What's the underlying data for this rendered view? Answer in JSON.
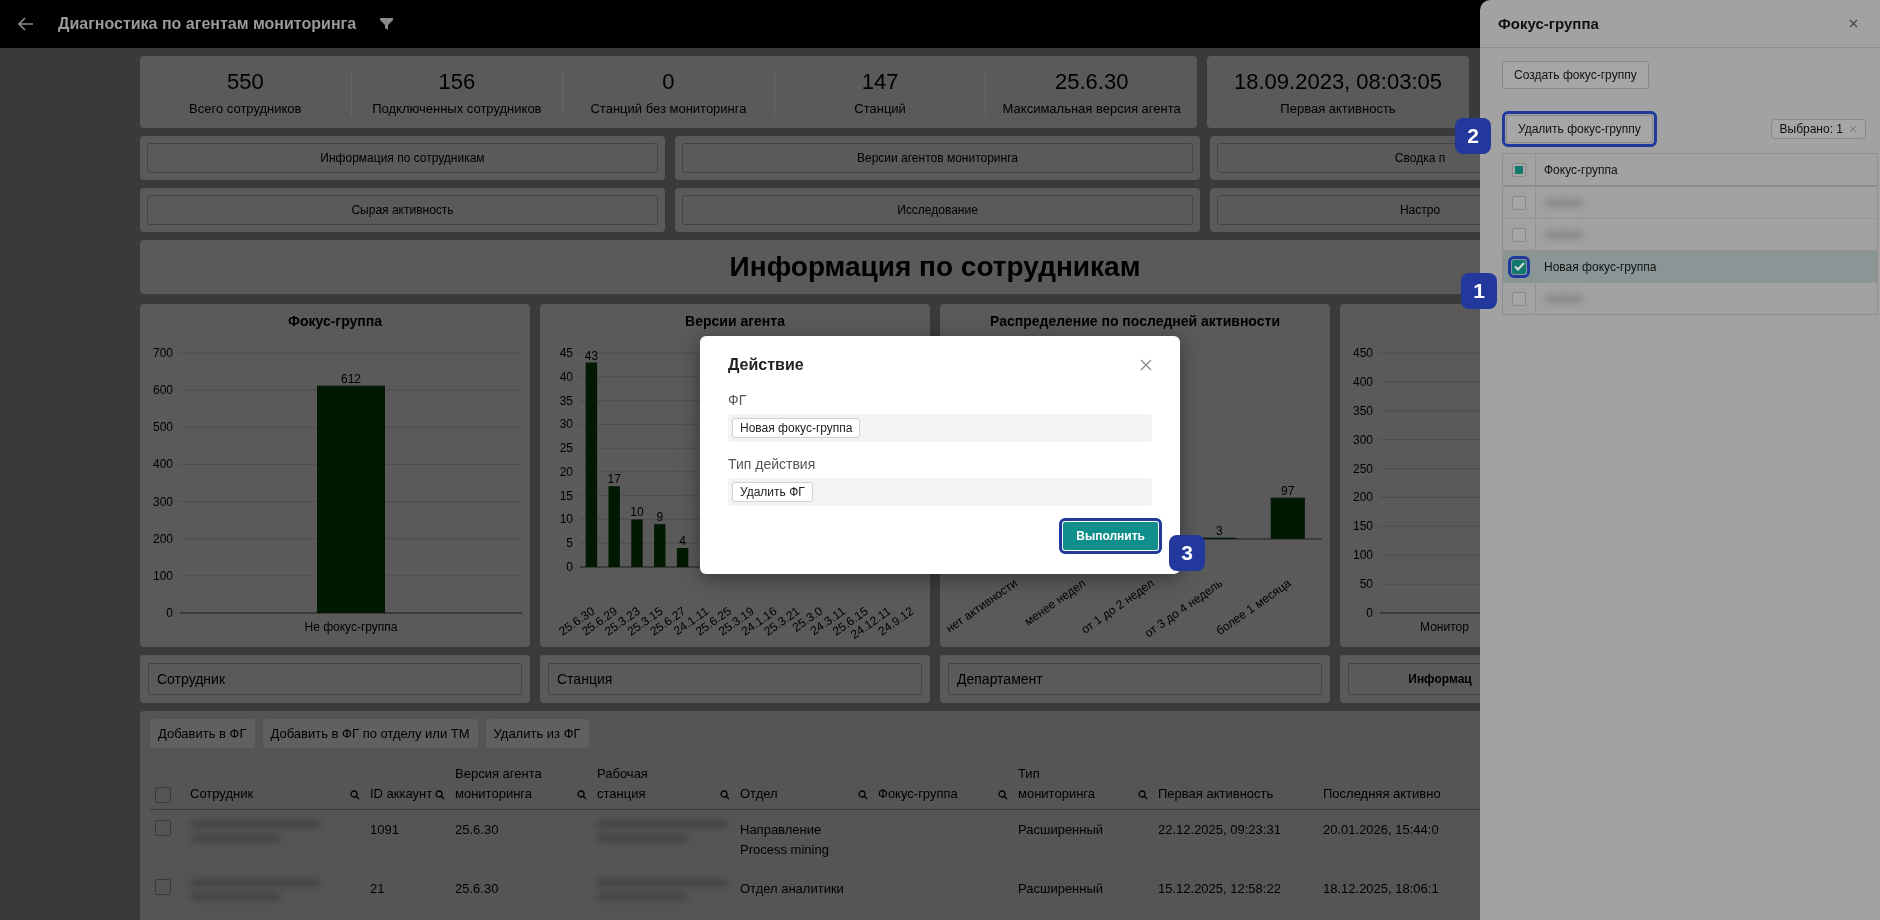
{
  "header": {
    "title": "Диагностика по агентам мониторинга"
  },
  "stats": [
    {
      "value": "550",
      "label": "Всего сотрудников"
    },
    {
      "value": "156",
      "label": "Подключенных сотрудников"
    },
    {
      "value": "0",
      "label": "Станций без мониторинга"
    },
    {
      "value": "147",
      "label": "Станций"
    },
    {
      "value": "25.6.30",
      "label": "Максимальная версия агента"
    }
  ],
  "first_activity": {
    "value": "18.09.2023, 08:03:05",
    "label": "Первая активность"
  },
  "nav_rows": [
    {
      "buttons": [
        "Информация по сотрудникам",
        "Версии агентов мониторинга",
        "Сводка п"
      ]
    },
    {
      "buttons": [
        "Сырая активность",
        "Исследование",
        "Настро"
      ]
    }
  ],
  "section_title": "Информация по сотрудникам",
  "charts": [
    {
      "title": "Фокус-группа",
      "chart_data": {
        "type": "bar",
        "categories": [
          "Не фокус-группа"
        ],
        "values": [
          612
        ],
        "ylim": [
          0,
          700
        ],
        "yticks": [
          0,
          100,
          200,
          300,
          400,
          500,
          600,
          700
        ],
        "grid": true,
        "value_labels": [
          "612"
        ]
      }
    },
    {
      "title": "Версии агента",
      "chart_data": {
        "type": "bar",
        "categories": [
          "25.6.30",
          "25.6.29",
          "25.3.23",
          "25.3.15",
          "25.6.27",
          "24.1.11",
          "25.6.25",
          "25.3.19",
          "24.1.16",
          "25.3.21",
          "25.3.0",
          "24.3.11",
          "25.6.15",
          "24.12.11",
          "24.9.12"
        ],
        "values": [
          43,
          17,
          10,
          9,
          4,
          null,
          null,
          null,
          null,
          null,
          null,
          null,
          null,
          null,
          null
        ],
        "ylim": [
          0,
          45
        ],
        "yticks": [
          0,
          5,
          10,
          15,
          20,
          25,
          30,
          35,
          40,
          45
        ],
        "grid": true,
        "value_labels": [
          "43",
          "17",
          "10",
          "9",
          "4",
          null,
          null,
          null,
          null,
          null,
          null,
          null,
          null,
          null,
          null
        ]
      }
    },
    {
      "title": "Распределение по последней активности",
      "chart_data": {
        "type": "bar",
        "categories": [
          "нет активности",
          "менее недел",
          "от 1 до 2 недел",
          "от 3 до 4 недель",
          "более 1 месяца"
        ],
        "values": [
          null,
          null,
          null,
          3,
          97
        ],
        "value_labels": [
          null,
          null,
          null,
          "3",
          "97"
        ]
      }
    },
    {
      "chart_data": {
        "type": "bar",
        "categories": [
          "Монитор"
        ],
        "values": [
          null
        ],
        "ylim": [
          0,
          450
        ],
        "yticks": [
          0,
          50,
          100,
          150,
          200,
          250,
          300,
          350,
          400,
          450
        ],
        "grid": true
      }
    }
  ],
  "filters": [
    {
      "placeholder": "Сотрудник"
    },
    {
      "placeholder": "Станция"
    },
    {
      "placeholder": "Департамент"
    }
  ],
  "filter_button": "Информац",
  "table": {
    "actions": [
      "Добавить в ФГ",
      "Добавить в ФГ по отделу или ТМ",
      "Удалить из ФГ"
    ],
    "all_checked": false,
    "columns": [
      {
        "label": "Сотрудник",
        "searchable": true
      },
      {
        "label": "ID аккаунт",
        "searchable": true
      },
      {
        "label": "Версия агента мониторинга",
        "searchable": true
      },
      {
        "label": "Рабочая станция",
        "searchable": true
      },
      {
        "label": "Отдел",
        "searchable": true
      },
      {
        "label": "Фокус-группа",
        "searchable": true
      },
      {
        "label": "Тип мониторинга",
        "searchable": true
      },
      {
        "label": "Первая активность",
        "searchable": false
      },
      {
        "label": "Последняя активно",
        "searchable": false
      }
    ],
    "rows": [
      {
        "checked": false,
        "cells": [
          {
            "kind": "redacted"
          },
          {
            "kind": "text",
            "text": "1091"
          },
          {
            "kind": "text",
            "text": "25.6.30"
          },
          {
            "kind": "redacted"
          },
          {
            "kind": "text",
            "text": "Направление Process mining"
          },
          {
            "kind": "empty"
          },
          {
            "kind": "text",
            "text": "Расширенный"
          },
          {
            "kind": "text",
            "text": "22.12.2025, 09:23:31"
          },
          {
            "kind": "text",
            "text": "20.01.2026, 15:44:0"
          }
        ]
      },
      {
        "checked": false,
        "cells": [
          {
            "kind": "redacted"
          },
          {
            "kind": "text",
            "text": "21"
          },
          {
            "kind": "text",
            "text": "25.6.30"
          },
          {
            "kind": "redacted"
          },
          {
            "kind": "text",
            "text": "Отдел аналитики"
          },
          {
            "kind": "empty"
          },
          {
            "kind": "text",
            "text": "Расширенный"
          },
          {
            "kind": "text",
            "text": "15.12.2025, 12:58:22"
          },
          {
            "kind": "text",
            "text": "18.12.2025, 18:06:1"
          }
        ]
      }
    ]
  },
  "drawer": {
    "title": "Фокус-группа",
    "create_button": "Создать фокус-группу",
    "delete_button": {
      "label": "Удалить фокус-группу",
      "callout": "2"
    },
    "selected_count": "Выбрано: 1",
    "header_partial": true,
    "column": "Фокус-группа",
    "rows": [
      {
        "kind": "redacted",
        "checked": false,
        "selected": false
      },
      {
        "kind": "redacted",
        "checked": false,
        "selected": false
      },
      {
        "kind": "text",
        "label": "Новая фокус-группа",
        "checked": true,
        "selected": true,
        "callout": "1"
      },
      {
        "kind": "redacted",
        "checked": false,
        "selected": false
      }
    ]
  },
  "modal": {
    "title": "Действие",
    "fields": [
      {
        "label": "ФГ",
        "tags": [
          "Новая фокус-группа"
        ]
      },
      {
        "label": "Тип действия",
        "tags": [
          "Удалить ФГ"
        ]
      }
    ],
    "submit": {
      "label": "Выполнить",
      "callout": "3"
    }
  }
}
